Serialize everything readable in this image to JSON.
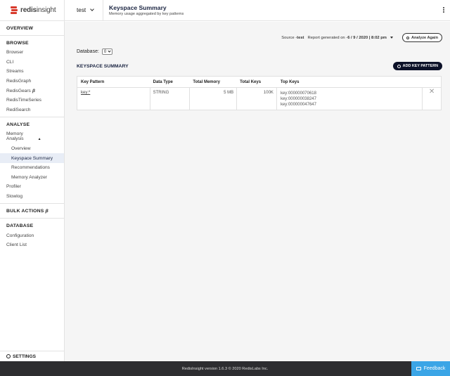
{
  "app": {
    "logo_text_a": "redis",
    "logo_text_b": "insight"
  },
  "header": {
    "database": "test",
    "title": "Keyspace Summary",
    "subtitle": "Memory usage aggregated by key patterns"
  },
  "sidebar": {
    "overview": "OVERVIEW",
    "browse_head": "BROWSE",
    "browse_items": [
      "Browser",
      "CLI",
      "Streams",
      "RedisGraph",
      "RedisGears",
      "RedisTimeSeries",
      "RediSearch"
    ],
    "beta": "β",
    "analyse_head": "ANALYSE",
    "memory_analysis": "Memory Analysis",
    "memory_sub": [
      "Overview",
      "Keyspace Summary",
      "Recommendations",
      "Memory Analyzer"
    ],
    "profiler": "Profiler",
    "slowlog": "Slowlog",
    "bulk_actions": "BULK ACTIONS",
    "database_head": "DATABASE",
    "database_items": [
      "Configuration",
      "Client List"
    ],
    "settings": "SETTINGS"
  },
  "report": {
    "source_label": "Source - ",
    "source_value": "test",
    "generated_label": "Report generated on - ",
    "generated_value": "6 / 9 / 2020 | 8:02 pm",
    "analyze_again": "Analyze Again"
  },
  "db_filter": {
    "label": "Database:",
    "value": "0"
  },
  "section": {
    "title": "KEYSPACE SUMMARY",
    "add_button": "ADD KEY PATTERN"
  },
  "table": {
    "headers": [
      "Key Pattern",
      "Data Type",
      "Total Memory",
      "Total Keys",
      "Top Keys"
    ],
    "rows": [
      {
        "pattern": "key:*",
        "type": "STRING",
        "memory": "5 MB",
        "keys": "100K",
        "top_keys": [
          "key:000000070618",
          "key:000000038247",
          "key:000000047647"
        ]
      }
    ],
    "remove_glyph": "✕"
  },
  "footer": {
    "text": "RedisInsight version 1.6.3 © 2020 RedisLabs Inc.",
    "feedback": "Feedback"
  }
}
